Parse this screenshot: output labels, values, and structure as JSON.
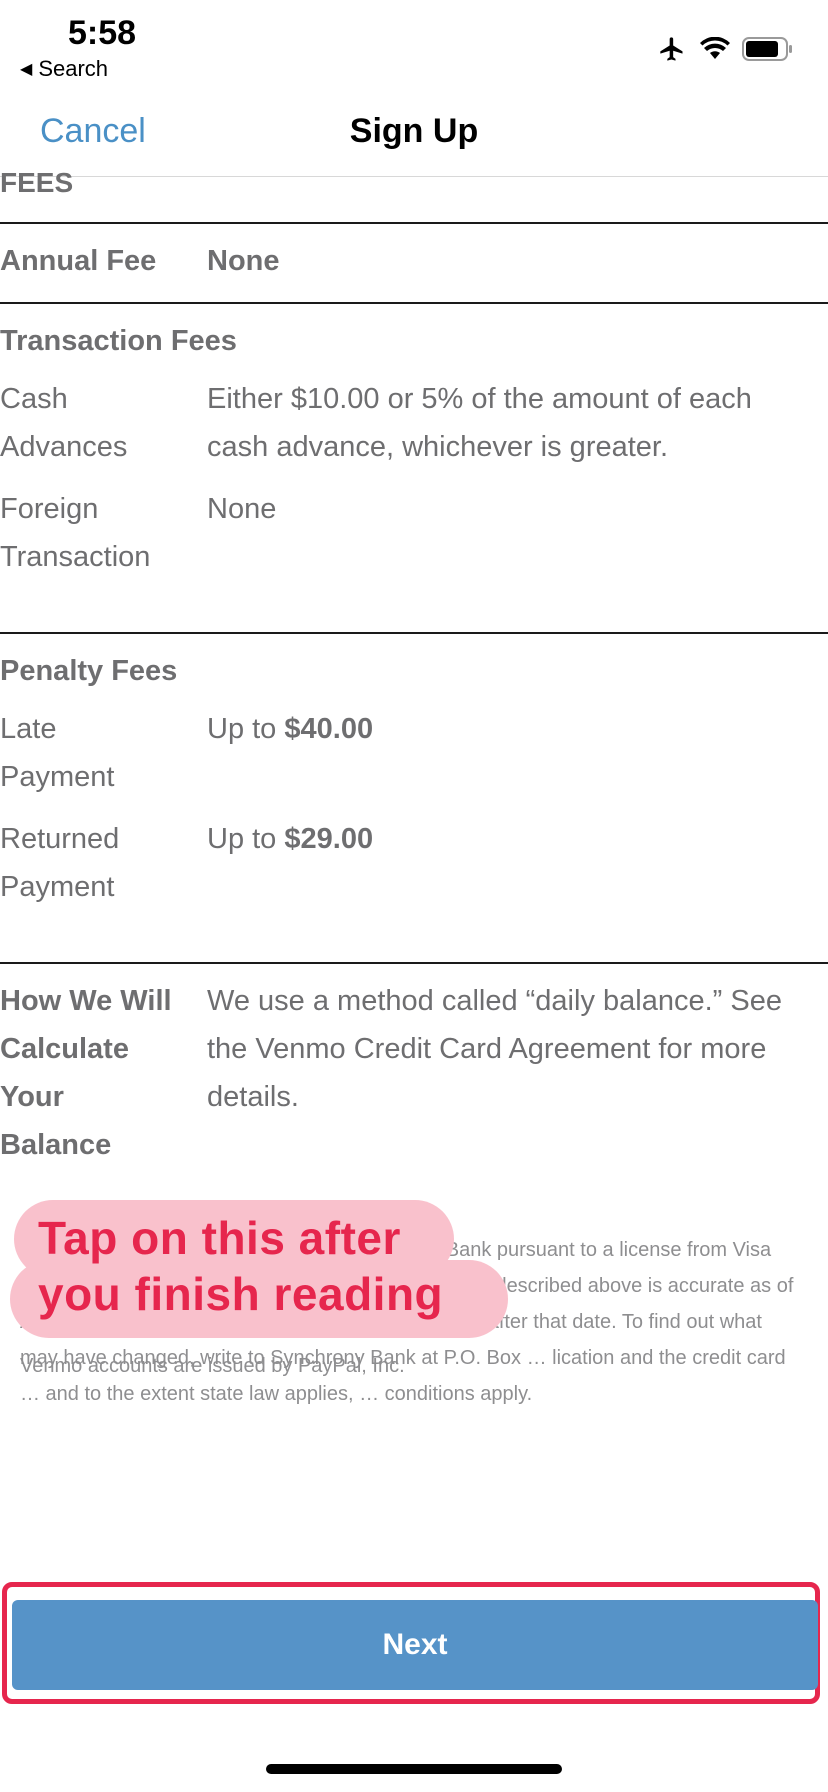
{
  "status_bar": {
    "time": "5:58",
    "back_label": "Search"
  },
  "nav": {
    "cancel_label": "Cancel",
    "title": "Sign Up"
  },
  "fees_heading": "FEES",
  "annual_fee": {
    "label": "Annual Fee",
    "value": "None"
  },
  "transaction_fees": {
    "heading": "Transaction Fees",
    "rows": [
      {
        "label": "Cash Advances",
        "value": "Either $10.00 or 5% of the amount of each cash advance, whichever is greater."
      },
      {
        "label": "Foreign Transaction",
        "value": "None"
      }
    ]
  },
  "penalty_fees": {
    "heading": "Penalty Fees",
    "rows": [
      {
        "label": "Late Payment",
        "value_prefix": "Up to ",
        "value_amount": "$40.00"
      },
      {
        "label": "Returned Payment",
        "value_prefix": "Up to ",
        "value_amount": "$29.00"
      }
    ]
  },
  "balance": {
    "label": "How We Will Calculate Your Balance",
    "value": "We use a method called “daily balance.” See the Venmo Credit Card Agreement for more details."
  },
  "disclaimer": "The Venmo Credit Card is issued by Synchrony Bank pursuant to a license from Visa USA, Inc. The information about the costs of the card described above is accurate as of August 1, 2020. This information may have changed after that date. To find out what may have changed, write to Synchrony Bank at P.O. Box … lication and the credit card … and to the extent state law applies, … conditions apply.",
  "venmo_note": "Venmo accounts are issued by PayPal, Inc.",
  "tooltip": {
    "line1": "Tap on this after",
    "line2": "you finish reading"
  },
  "next_label": "Next",
  "colors": {
    "accent": "#4a90c6",
    "button": "#5693c8",
    "highlight": "#e6264d",
    "tooltip_bg": "#f9c1cc"
  }
}
